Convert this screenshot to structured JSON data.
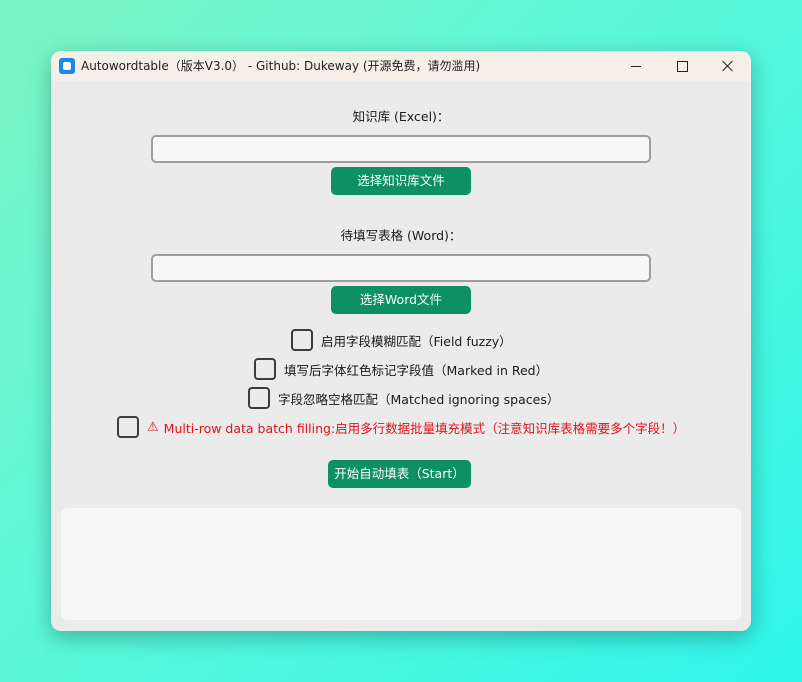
{
  "window": {
    "title": "Autowordtable（版本V3.0） - Github: Dukeway (开源免费，请勿滥用)"
  },
  "knowledge": {
    "label": "知识库 (Excel)：",
    "value": "",
    "button_label": "选择知识库文件"
  },
  "word": {
    "label": "待填写表格 (Word)：",
    "value": "",
    "button_label": "选择Word文件"
  },
  "options": {
    "fuzzy_label": "启用字段模糊匹配（Field fuzzy）",
    "red_label": "填写后字体红色标记字段值（Marked in Red）",
    "spaces_label": "字段忽略空格匹配（Matched ignoring spaces）",
    "multirow_icon": "⚠",
    "multirow_label": "Multi-row data batch filling:启用多行数据批量填充模式（注意知识库表格需要多个字段！）"
  },
  "start_button_label": "开始自动填表（Start）",
  "log": {
    "text": ""
  },
  "colors": {
    "accent": "#0c9064",
    "warning": "#e0121a",
    "window_bg": "#ebebeb"
  }
}
